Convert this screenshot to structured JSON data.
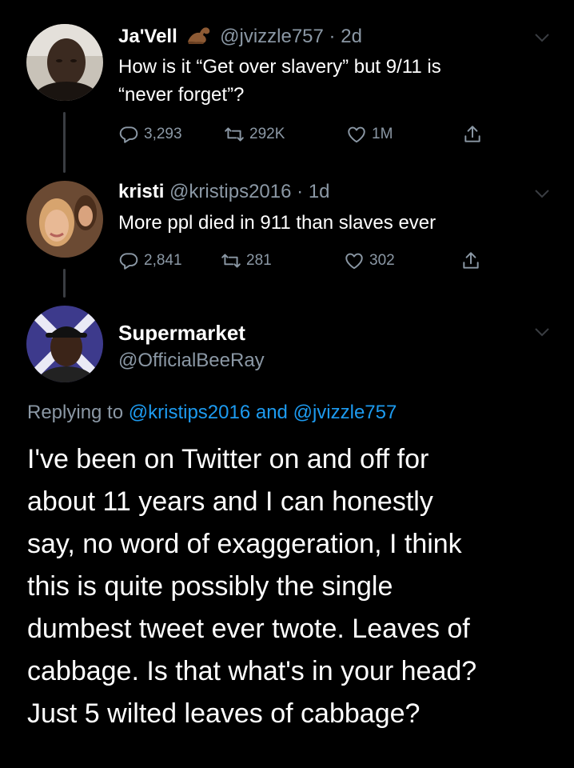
{
  "tweets": [
    {
      "name": "Ja'Vell",
      "name_emoji_icon": "muscle-arm-emoji-icon",
      "handle": "@jvizzle757",
      "separator": "·",
      "time": "2d",
      "text_line1": "How is it “Get over slavery” but 9/11 is",
      "text_line2": "“never forget”?",
      "replies": "3,293",
      "retweets": "292K",
      "likes": "1M"
    },
    {
      "name": "kristi",
      "handle": "@kristips2016",
      "separator": "·",
      "time": "1d",
      "text_line1": "More ppl died in 911 than slaves ever",
      "replies": "2,841",
      "retweets": "281",
      "likes": "302"
    }
  ],
  "main_tweet": {
    "name": "Supermarket",
    "handle": "@OfficialBeeRay",
    "replying_prefix": "Replying to",
    "replying_user1": "@kristips2016",
    "replying_and": "and",
    "replying_user2": "@jvizzle757",
    "text_lines": [
      "I've been on Twitter on and off for",
      "about 11 years and I can honestly",
      "say, no word of exaggeration, I think",
      "this is quite possibly the single",
      "dumbest tweet ever twote. Leaves of",
      "cabbage. Is that what's in your head?",
      "Just 5 wilted leaves of cabbage?"
    ]
  },
  "colors": {
    "background": "#000000",
    "text": "#ffffff",
    "muted": "#8b98a5",
    "link": "#1d9bf0",
    "thread_line": "#3a3d42"
  }
}
